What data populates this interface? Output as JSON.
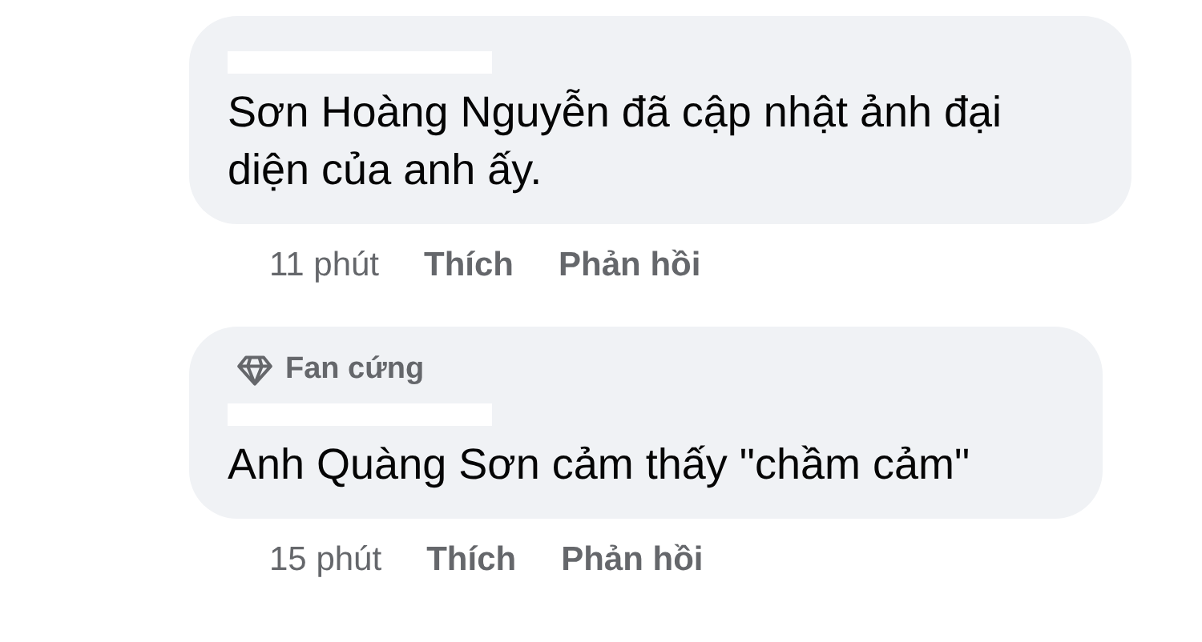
{
  "comments": [
    {
      "text": "Sơn Hoàng Nguyễn đã cập nhật ảnh đại diện của anh ấy.",
      "time": "11 phút",
      "actions": [
        "Thích",
        "Phản hồi"
      ]
    },
    {
      "badge": "Fan cứng",
      "text": "Anh Quàng Sơn cảm thấy \"chầm cảm\"",
      "time": "15 phút",
      "actions": [
        "Thích",
        "Phản hồi"
      ]
    }
  ]
}
